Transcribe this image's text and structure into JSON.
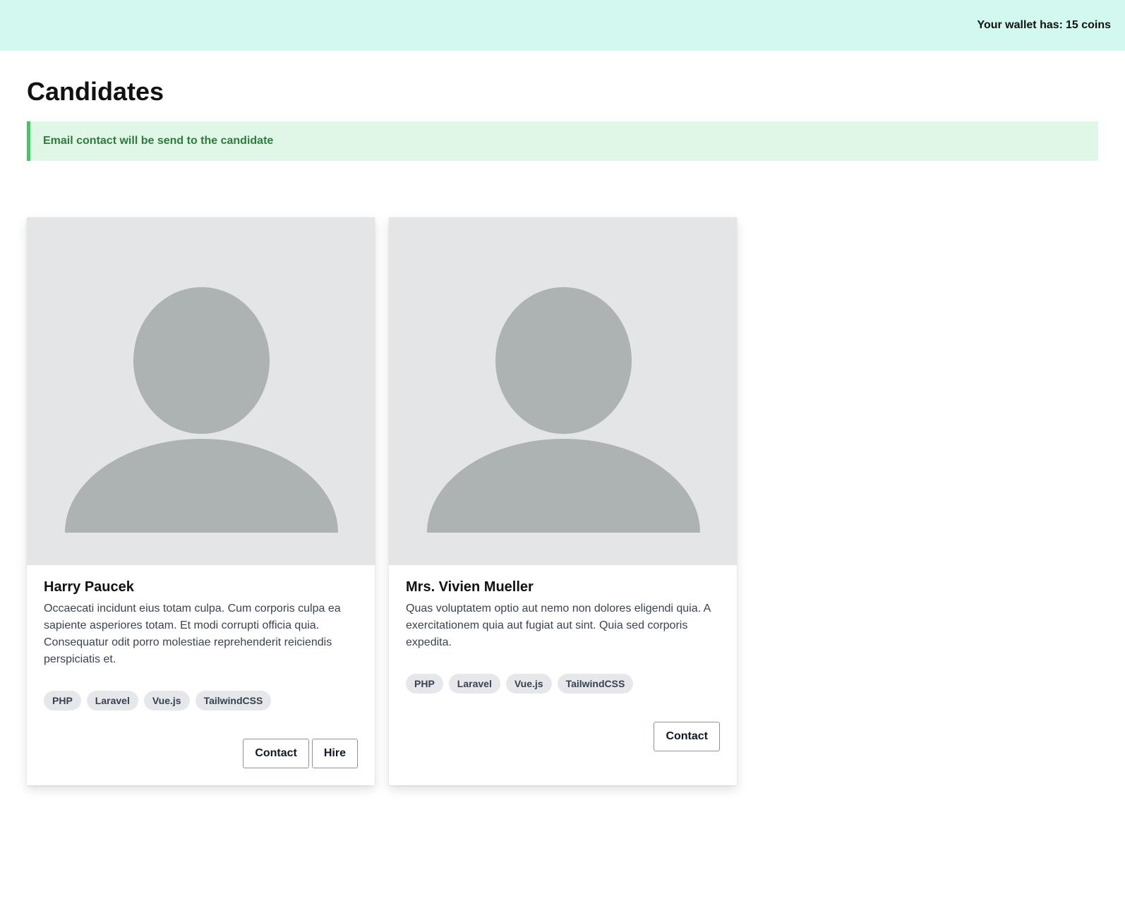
{
  "header": {
    "wallet_label": "Your wallet has:",
    "wallet_amount": "15 coins"
  },
  "main": {
    "title": "Candidates",
    "alert": {
      "message": "Email contact will be send to the candidate",
      "type": "success"
    }
  },
  "candidates": [
    {
      "name": "Harry Paucek",
      "description": "Occaecati incidunt eius totam culpa. Cum corporis culpa ea sapiente asperiores totam. Et modi corrupti officia quia. Consequatur odit porro molestiae reprehenderit reiciendis perspiciatis et.",
      "tags": [
        "PHP",
        "Laravel",
        "Vue.js",
        "TailwindCSS"
      ],
      "actions": {
        "contact": "Contact",
        "hire": "Hire"
      }
    },
    {
      "name": "Mrs. Vivien Mueller",
      "description": "Quas voluptatem optio aut nemo non dolores eligendi quia. A exercitationem quia aut fugiat aut sint. Quia sed corporis expedita.",
      "tags": [
        "PHP",
        "Laravel",
        "Vue.js",
        "TailwindCSS"
      ],
      "actions": {
        "contact": "Contact"
      }
    }
  ],
  "icons": {
    "avatar": "user-placeholder-icon"
  },
  "colors": {
    "header_bg": "#d3f8ef",
    "alert_bg": "#e0f7e6",
    "alert_border": "#4fbf6b",
    "alert_text": "#2f7a3e",
    "avatar_bg": "#e4e5e7",
    "avatar_fg": "#adb2b3",
    "tag_bg": "#e5e7eb"
  }
}
